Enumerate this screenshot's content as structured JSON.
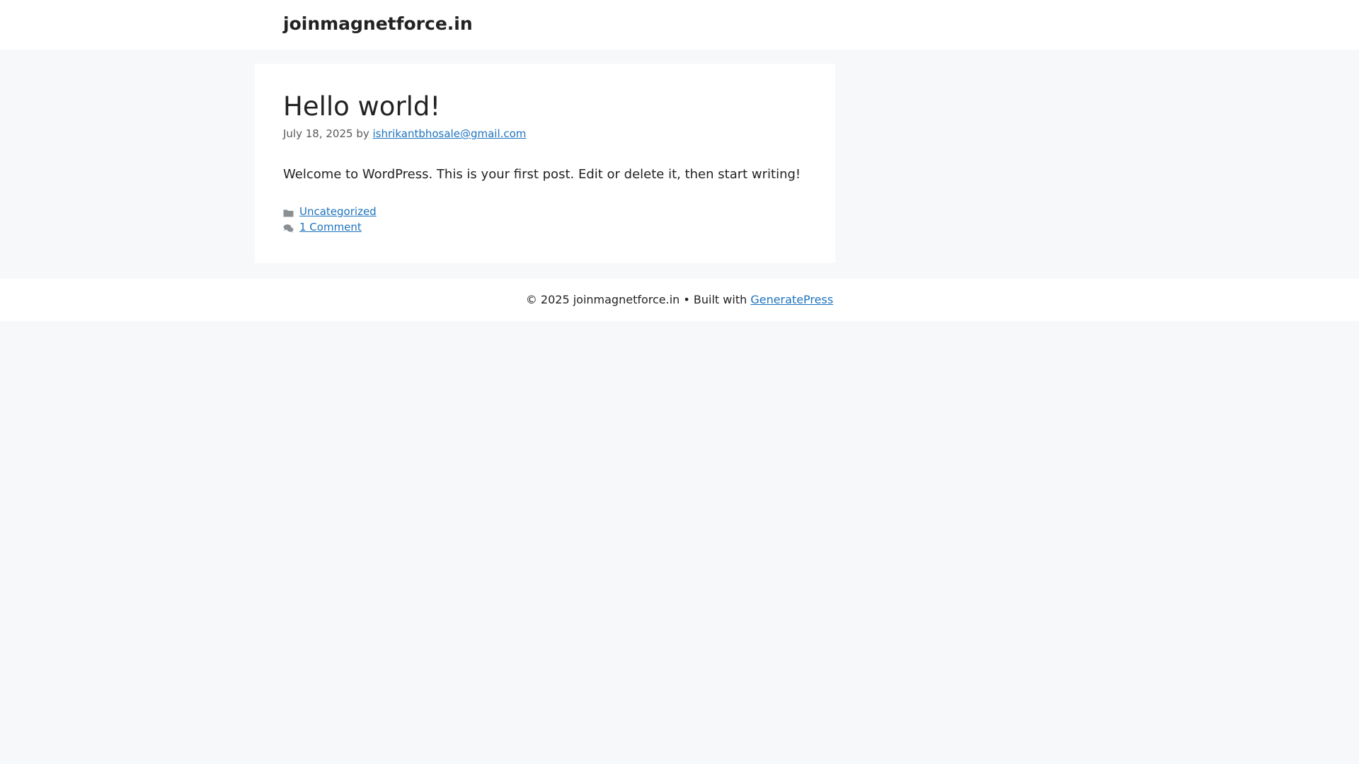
{
  "header": {
    "site_title": "joinmagnetforce.in"
  },
  "post": {
    "title": "Hello world!",
    "date": "July 18, 2025",
    "by_label": "by",
    "author": "ishrikantbhosale@gmail.com",
    "content": "Welcome to WordPress. This is your first post. Edit or delete it, then start writing!",
    "category": "Uncategorized",
    "comments": "1 Comment",
    "icons": {
      "category": "folder-icon",
      "comments": "comments-icon"
    }
  },
  "footer": {
    "copyright": "© 2025 joinmagnetforce.in • Built with",
    "theme_link": "GeneratePress"
  },
  "colors": {
    "background": "#f7f8f9",
    "surface": "#ffffff",
    "link": "#1e73be",
    "text": "#222222",
    "meta_text": "#595959"
  }
}
